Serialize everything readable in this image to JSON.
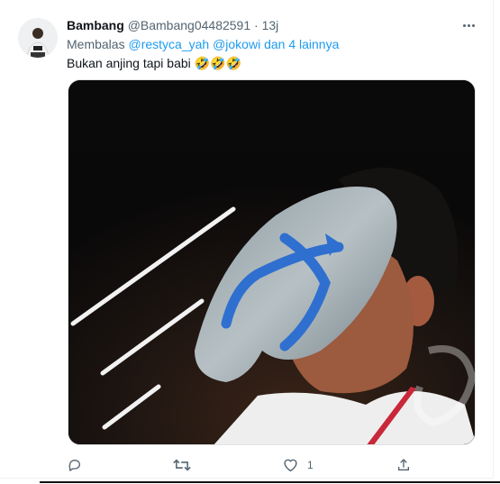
{
  "tweet": {
    "name": "Bambang",
    "handle": "@Bambang04482591",
    "separator": "·",
    "time": "13j",
    "reply_prefix": "Membalas",
    "reply_mentions": [
      "@restyca_yah",
      "@jokowi"
    ],
    "reply_suffix": "dan 4 lainnya",
    "text": "Bukan anjing tapi babi 🤣🤣🤣",
    "likes": "1"
  },
  "icons": {
    "more": "more-icon",
    "reply": "reply-icon",
    "retweet": "retweet-icon",
    "like": "heart-icon",
    "share": "share-icon"
  },
  "colors": {
    "link": "#1d9bf0",
    "secondary": "#536471",
    "text": "#0f1419"
  }
}
